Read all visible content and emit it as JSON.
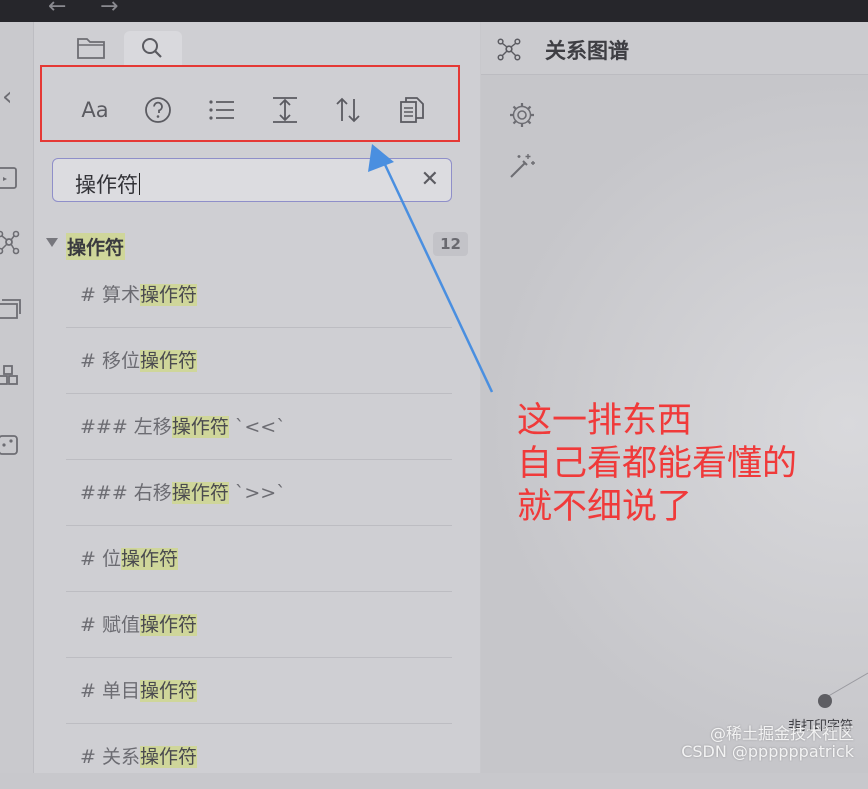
{
  "sidebar": {
    "tabs": [
      {
        "icon": "folder-icon"
      },
      {
        "icon": "search-icon"
      }
    ],
    "toolbar": {
      "font_label": "Aa",
      "icons": [
        "match-case-icon",
        "help-icon",
        "list-icon",
        "expand-icon",
        "sort-icon",
        "copy-icon"
      ]
    },
    "search": {
      "value": "操作符"
    },
    "group": {
      "title": "操作符",
      "count": "12"
    },
    "results": [
      {
        "prefix": "# 算术",
        "match": "操作符",
        "suffix": ""
      },
      {
        "prefix": "# 移位",
        "match": "操作符",
        "suffix": ""
      },
      {
        "prefix": "### 左移",
        "match": "操作符",
        "suffix": " `<<`"
      },
      {
        "prefix": "### 右移",
        "match": "操作符",
        "suffix": " `>>`"
      },
      {
        "prefix": "# 位",
        "match": "操作符",
        "suffix": ""
      },
      {
        "prefix": "# 赋值",
        "match": "操作符",
        "suffix": ""
      },
      {
        "prefix": "# 单目",
        "match": "操作符",
        "suffix": ""
      },
      {
        "prefix": "# 关系",
        "match": "操作符",
        "suffix": ""
      }
    ]
  },
  "main": {
    "title": "关系图谱",
    "graph_node_label": "非打印字符"
  },
  "annotation": {
    "lines": [
      "这一排东西",
      "自己看都能看懂的",
      "就不细说了"
    ],
    "color": "#f03a3a"
  },
  "watermark": {
    "line1": "@稀土掘金技术社区",
    "line2": "CSDN @ppppppatrick"
  },
  "colors": {
    "highlight": "#cfd69a",
    "toolbar_box": "#e53935",
    "arrow": "#4a8fe0"
  }
}
